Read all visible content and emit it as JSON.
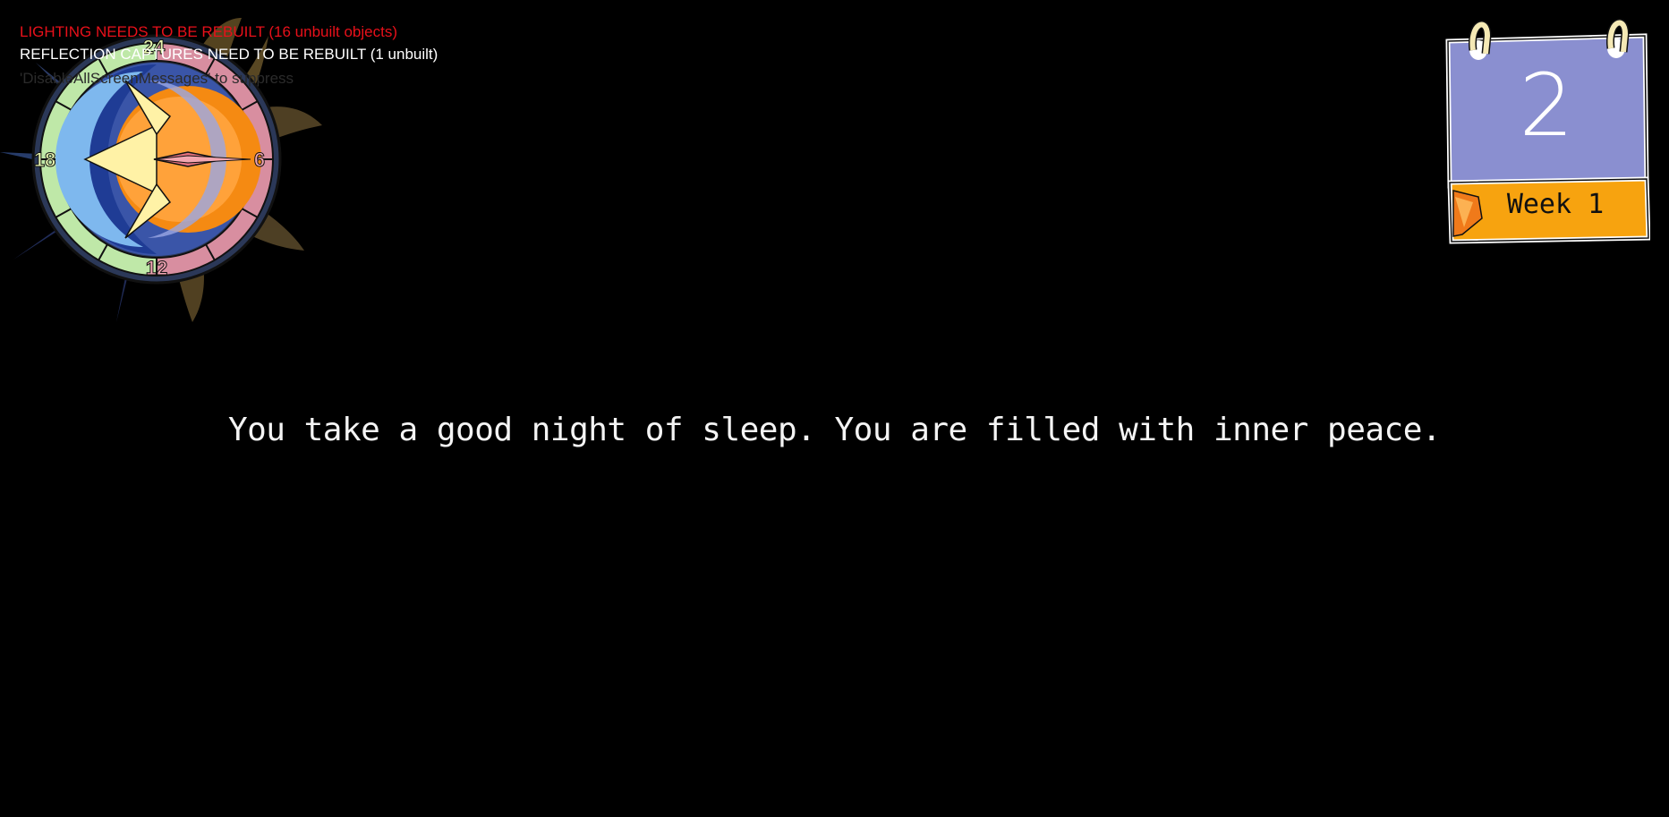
{
  "debug": {
    "lighting_warning": "LIGHTING NEEDS TO BE REBUILT (16 unbuilt objects)",
    "reflection_warning": "REFLECTION CAPTURES NEED TO BE REBUILT (1 unbuilt)",
    "suppress_hint": "'DisableAllScreenMessages' to suppress"
  },
  "clock": {
    "labels": {
      "top": "24",
      "right": "6",
      "bottom": "12",
      "left": "18"
    }
  },
  "calendar": {
    "day": "2",
    "week": "Week 1"
  },
  "narration": {
    "text": "You take a good night of sleep. You are filled with inner peace."
  },
  "colors": {
    "background": "#000000",
    "warning_red": "#e8101a",
    "calendar_top": "#8a8fd0",
    "calendar_bottom": "#f7a30f",
    "sun_orange": "#f48a12",
    "moon_blue": "#2848a0"
  },
  "icons": [
    "day-night-clock-icon",
    "sun-icon",
    "moon-icon",
    "clock-hand-icon",
    "calendar-icon"
  ]
}
